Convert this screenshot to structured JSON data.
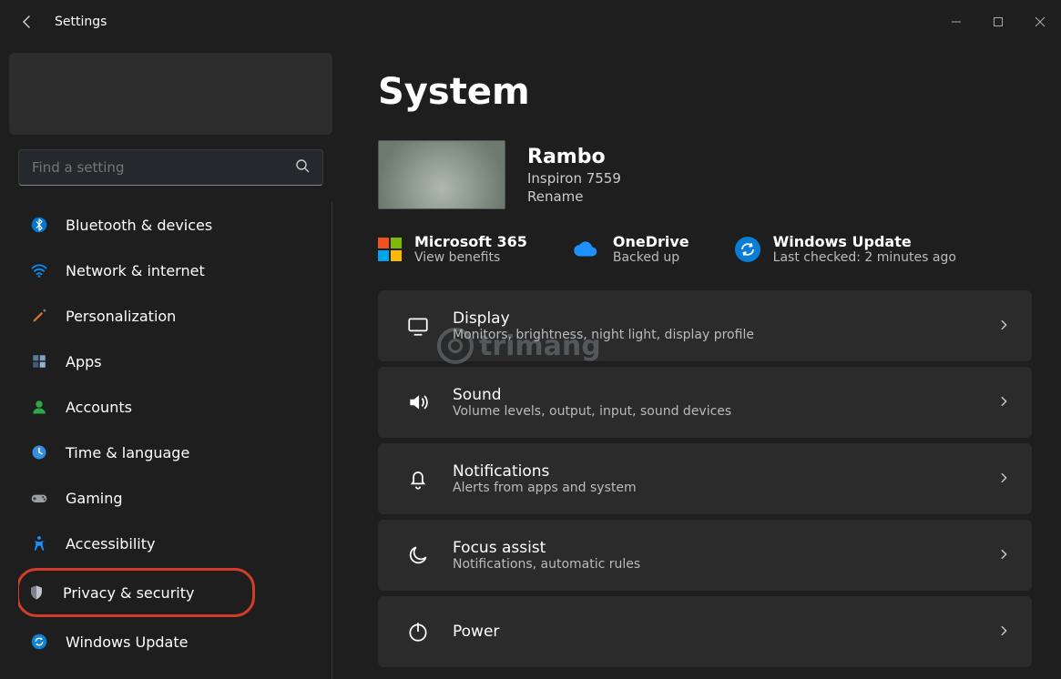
{
  "app_title": "Settings",
  "search": {
    "placeholder": "Find a setting"
  },
  "sidebar": {
    "items": [
      {
        "label": "Bluetooth & devices",
        "icon": "bluetooth-icon",
        "color": "#0078d4"
      },
      {
        "label": "Network & internet",
        "icon": "wifi-icon",
        "color": "#0091ff"
      },
      {
        "label": "Personalization",
        "icon": "brush-icon",
        "color": "#d07030"
      },
      {
        "label": "Apps",
        "icon": "apps-icon",
        "color": "#6a8caf"
      },
      {
        "label": "Accounts",
        "icon": "person-icon",
        "color": "#2fa84a"
      },
      {
        "label": "Time & language",
        "icon": "clock-icon",
        "color": "#3a8dde"
      },
      {
        "label": "Gaming",
        "icon": "gamepad-icon",
        "color": "#9aa0a6"
      },
      {
        "label": "Accessibility",
        "icon": "accessibility-icon",
        "color": "#1e90ff"
      },
      {
        "label": "Privacy & security",
        "icon": "shield-icon",
        "color": "#8a8d93",
        "highlighted": true
      },
      {
        "label": "Windows Update",
        "icon": "windows-update-icon",
        "color": "#0b84d4"
      }
    ]
  },
  "page": {
    "title": "System",
    "device": {
      "name": "Rambo",
      "model": "Inspiron 7559",
      "rename_label": "Rename"
    },
    "status": [
      {
        "title": "Microsoft 365",
        "sub": "View benefits",
        "icon": "m365"
      },
      {
        "title": "OneDrive",
        "sub": "Backed up",
        "icon": "cloud"
      },
      {
        "title": "Windows Update",
        "sub": "Last checked: 2 minutes ago",
        "icon": "sync"
      }
    ],
    "settings": [
      {
        "title": "Display",
        "sub": "Monitors, brightness, night light, display profile",
        "icon": "display-icon"
      },
      {
        "title": "Sound",
        "sub": "Volume levels, output, input, sound devices",
        "icon": "sound-icon"
      },
      {
        "title": "Notifications",
        "sub": "Alerts from apps and system",
        "icon": "bell-icon"
      },
      {
        "title": "Focus assist",
        "sub": "Notifications, automatic rules",
        "icon": "moon-icon"
      },
      {
        "title": "Power",
        "sub": "",
        "icon": "power-icon"
      }
    ]
  },
  "watermark": "trimang"
}
